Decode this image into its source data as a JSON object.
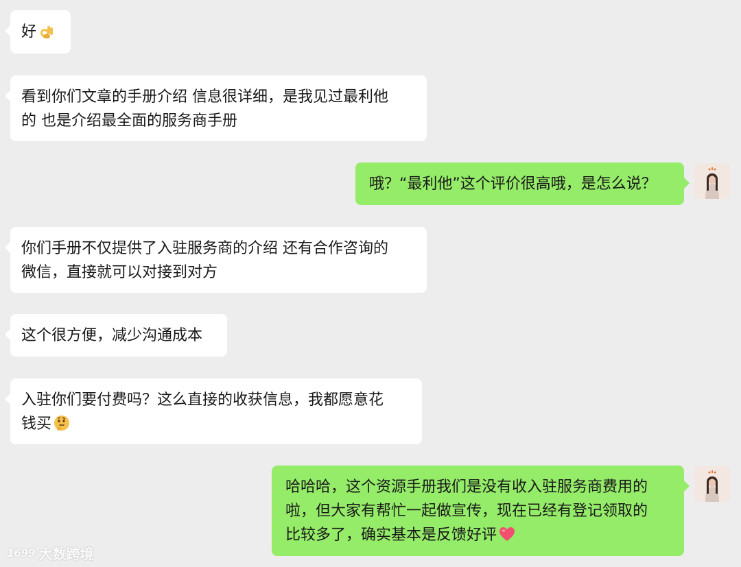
{
  "messages": [
    {
      "side": "left",
      "text": "好",
      "emoji": "ok-hand-emoji"
    },
    {
      "side": "left",
      "lines": [
        "看到你们文章的手册介绍 信息很详细，是我见过最利他",
        "的 也是介绍最全面的服务商手册"
      ]
    },
    {
      "side": "right",
      "text": "哦？“最利他”这个评价很高哦，是怎么说？"
    },
    {
      "side": "left",
      "lines": [
        "你们手册不仅提供了入驻服务商的介绍 还有合作咨询的",
        "微信，直接就可以对接到对方"
      ]
    },
    {
      "side": "left",
      "text": "这个很方便，减少沟通成本"
    },
    {
      "side": "left",
      "lines": [
        "入驻你们要付费吗？这么直接的收获信息，我都愿意花",
        "钱买"
      ],
      "emoji": "thinking-face-emoji"
    },
    {
      "side": "right",
      "lines": [
        "哈哈哈，这个资源手册我们是没有收入驻服务商费用的",
        "啦，但大家有帮忙一起做宣传，现在已经有登记领取的",
        "比较多了，确实基本是反馈好评"
      ],
      "emoji": "heart-emoji"
    }
  ],
  "watermark": {
    "logo": "1699",
    "text": "大数跨境"
  },
  "colors": {
    "background": "#ededed",
    "incoming_bubble": "#ffffff",
    "outgoing_bubble": "#95ec69"
  }
}
